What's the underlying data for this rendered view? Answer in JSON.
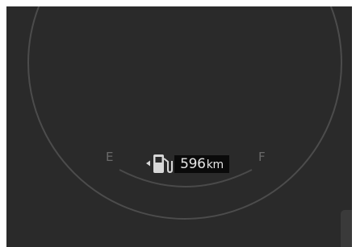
{
  "fuel_gauge": {
    "empty_label": "E",
    "full_label": "F",
    "range_value": "596",
    "range_unit": "km",
    "icon": "fuel-pump-icon",
    "fuel_door_side": "left"
  },
  "colors": {
    "background": "#2a2a2a",
    "dial_ring": "#555555",
    "label_text": "#6a6a6a",
    "range_text": "#e6e6e6",
    "range_box": "#0a0a0a"
  }
}
